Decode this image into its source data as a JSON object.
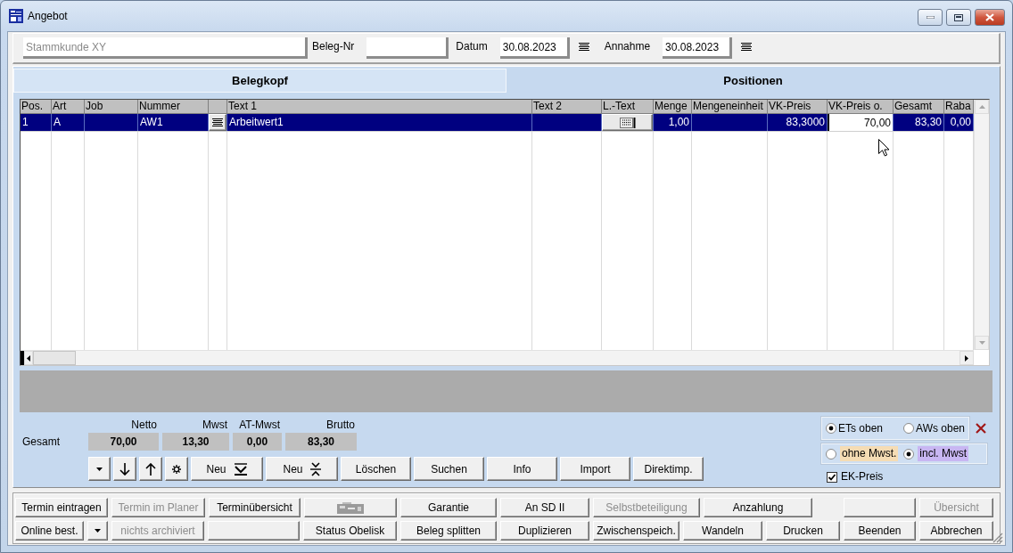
{
  "window": {
    "title": "Angebot"
  },
  "header": {
    "customer": {
      "placeholder": "Stammkunde XY"
    },
    "fields": [
      {
        "kind": "text",
        "label": "Beleg-Nr"
      },
      {
        "kind": "date",
        "label": "Datum",
        "value": "30.08.2023"
      },
      {
        "kind": "date",
        "label": "Annahme",
        "value": "30.08.2023"
      }
    ]
  },
  "tabs": [
    {
      "label": "Belegkopf",
      "selected": false
    },
    {
      "label": "Positionen",
      "selected": true
    }
  ],
  "table": {
    "columns": [
      {
        "label": "Pos."
      },
      {
        "label": "Art"
      },
      {
        "label": "Job"
      },
      {
        "label": "Nummer"
      },
      {},
      {
        "label": "Text 1"
      },
      {
        "label": "Text 2"
      },
      {
        "label": "L.-Text"
      },
      {
        "label": "Menge"
      },
      {
        "label": "Mengeneinheit"
      },
      {
        "label": "VK-Preis"
      },
      {
        "label": "VK-Preis o."
      },
      {
        "label": "Gesamt"
      },
      {
        "label": "Raba"
      }
    ],
    "rows": [
      {
        "selected": true,
        "cells": [
          {
            "kind": "text",
            "text": "1"
          },
          {
            "kind": "text",
            "text": "A"
          },
          {
            "kind": "empty"
          },
          {
            "kind": "text",
            "text": "AW1"
          },
          {
            "kind": "list_button"
          },
          {
            "kind": "text",
            "text": "Arbeitwert1"
          },
          {
            "kind": "empty"
          },
          {
            "kind": "notes_button"
          },
          {
            "kind": "number",
            "text": "1,00"
          },
          {
            "kind": "empty"
          },
          {
            "kind": "number",
            "text": "83,3000"
          },
          {
            "kind": "input",
            "value": "70,00"
          },
          {
            "kind": "number",
            "text": "83,30"
          },
          {
            "kind": "number",
            "text": "0,00"
          }
        ]
      }
    ]
  },
  "totals": {
    "label": "Gesamt",
    "items": [
      {
        "label": "Netto",
        "value": "70,00"
      },
      {
        "label": "Mwst",
        "value": "13,30"
      },
      {
        "label": "AT-Mwst",
        "value": "0,00"
      },
      {
        "label": "Brutto",
        "value": "83,30"
      }
    ]
  },
  "toolbar": [
    {
      "kind": "dropdown"
    },
    {
      "kind": "arrow_down"
    },
    {
      "kind": "arrow_up"
    },
    {
      "kind": "gear"
    },
    {
      "kind": "new_bottom",
      "label": "Neu"
    },
    {
      "kind": "new_between",
      "label": "Neu"
    },
    {
      "kind": "text",
      "label": "Löschen"
    },
    {
      "kind": "text",
      "label": "Suchen"
    },
    {
      "kind": "text",
      "label": "Info"
    },
    {
      "kind": "text",
      "label": "Import"
    },
    {
      "kind": "text",
      "label": "Direktimp."
    }
  ],
  "sort_options": [
    {
      "label": "ETs oben",
      "selected": true
    },
    {
      "label": "AWs oben",
      "selected": false
    }
  ],
  "tax_options": [
    {
      "label": "ohne Mwst.",
      "selected": false,
      "color": "#f5dcb4"
    },
    {
      "label": "incl. Mwst",
      "selected": true,
      "color": "#c8b6f2"
    }
  ],
  "ek_preis": {
    "label": "EK-Preis",
    "checked": true
  },
  "actions": [
    {
      "buttons": [
        {
          "kind": "text",
          "label": "Termin eintragen",
          "disabled": false
        },
        {
          "kind": "text",
          "label": "Termin im Planer",
          "disabled": true
        },
        {
          "kind": "text",
          "label": "Terminübersicht",
          "disabled": false
        },
        {
          "kind": "image",
          "disabled": false
        },
        {
          "kind": "text",
          "label": "Garantie",
          "disabled": false
        },
        {
          "kind": "text",
          "label": "An SD II",
          "disabled": false
        },
        {
          "kind": "text",
          "label": "Selbstbeteiligung",
          "disabled": true
        },
        {
          "kind": "text",
          "label": "Anzahlung",
          "disabled": false
        },
        {
          "kind": "blank"
        },
        {
          "kind": "text",
          "label": "Übersicht",
          "disabled": true
        }
      ]
    },
    {
      "buttons": [
        {
          "kind": "text",
          "label": "Online best.",
          "disabled": false
        },
        {
          "kind": "dropdown",
          "disabled": false
        },
        {
          "kind": "text",
          "label": "nichts archiviert",
          "disabled": true
        },
        {
          "kind": "blank"
        },
        {
          "kind": "text",
          "label": "Status Obelisk",
          "disabled": false
        },
        {
          "kind": "text",
          "label": "Beleg splitten",
          "disabled": false
        },
        {
          "kind": "text",
          "label": "Duplizieren",
          "disabled": false
        },
        {
          "kind": "text",
          "label": "Zwischenspeich.",
          "disabled": false
        },
        {
          "kind": "text",
          "label": "Wandeln",
          "disabled": false
        },
        {
          "kind": "text",
          "label": "Drucken",
          "disabled": false
        },
        {
          "kind": "text",
          "label": "Beenden",
          "disabled": false
        },
        {
          "kind": "text",
          "label": "Abbrechen",
          "disabled": false
        }
      ]
    }
  ]
}
